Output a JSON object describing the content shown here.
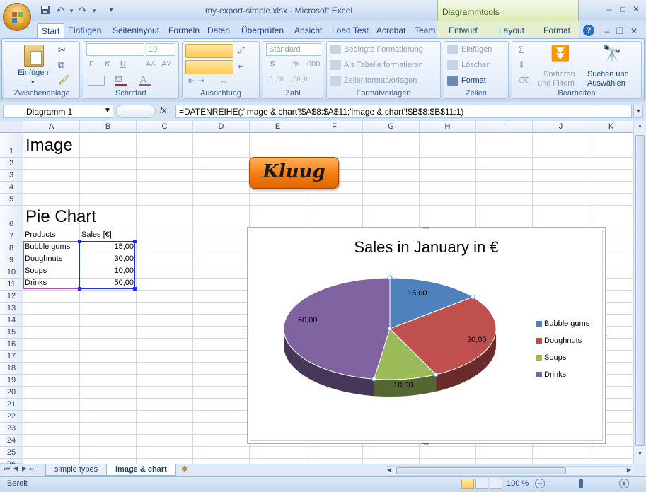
{
  "window": {
    "title": "my-export-simple.xlsx - Microsoft Excel",
    "context_tab": "Diagrammtools"
  },
  "tabs": [
    "Start",
    "Einfügen",
    "Seitenlayout",
    "Formeln",
    "Daten",
    "Überprüfen",
    "Ansicht",
    "Load Test",
    "Acrobat",
    "Team"
  ],
  "context_tabs": [
    "Entwurf",
    "Layout",
    "Format"
  ],
  "ribbon": {
    "groups": [
      "Zwischenablage",
      "Schriftart",
      "Ausrichtung",
      "Zahl",
      "Formatvorlagen",
      "Zellen",
      "Bearbeiten"
    ],
    "paste_label": "Einfügen",
    "font_size": "10",
    "number_format": "Standard",
    "conditional_formatting": "Bedingte Formatierung",
    "format_as_table": "Als Tabelle formatieren",
    "cell_styles": "Zellenformatvorlagen",
    "insert_cells": "Einfügen",
    "delete_cells": "Löschen",
    "format_cells": "Format",
    "sort_filter_1": "Sortieren",
    "sort_filter_2": "und Filtern",
    "find_select_1": "Suchen und",
    "find_select_2": "Auswählen",
    "bold": "F",
    "italic": "K",
    "underline": "U",
    "currency": "$",
    "percent": "%",
    "thousands": "000",
    "sigma": "Σ"
  },
  "formula_bar": {
    "name_box": "Diagramm 1",
    "fx": "fx",
    "formula": "=DATENREIHE(;'image & chart'!$A$8:$A$11;'image & chart'!$B$8:$B$11;1)"
  },
  "columns": [
    "A",
    "B",
    "C",
    "D",
    "E",
    "F",
    "G",
    "H",
    "I",
    "J",
    "K"
  ],
  "rows": [
    "1",
    "2",
    "3",
    "4",
    "5",
    "6",
    "7",
    "8",
    "9",
    "10",
    "11",
    "12",
    "13",
    "14",
    "15",
    "16",
    "17",
    "18",
    "19",
    "20",
    "21",
    "22",
    "23",
    "24",
    "25",
    "26"
  ],
  "cells": {
    "a1": "Image",
    "a6": "Pie Chart",
    "a7": "Products",
    "b7": "Sales [€]",
    "a8": "Bubble gums",
    "b8": "15,00",
    "a9": "Doughnuts",
    "b9": "30,00",
    "a10": "Soups",
    "b10": "10,00",
    "a11": "Drinks",
    "b11": "50,00"
  },
  "logo": {
    "text": "Kluug"
  },
  "chart_data": {
    "type": "pie",
    "title": "Sales in January in €",
    "categories": [
      "Bubble gums",
      "Doughnuts",
      "Soups",
      "Drinks"
    ],
    "values": [
      15,
      30,
      10,
      50
    ],
    "data_labels": [
      "15,00",
      "30,00",
      "10,00",
      "50,00"
    ],
    "colors": [
      "#4f81bd",
      "#c0504d",
      "#9bbb59",
      "#8064a2"
    ],
    "legend_position": "right",
    "style": "3d"
  },
  "sheet_tabs": [
    "simple types",
    "image & chart"
  ],
  "status": {
    "mode": "Bereit",
    "zoom": "100 %"
  }
}
